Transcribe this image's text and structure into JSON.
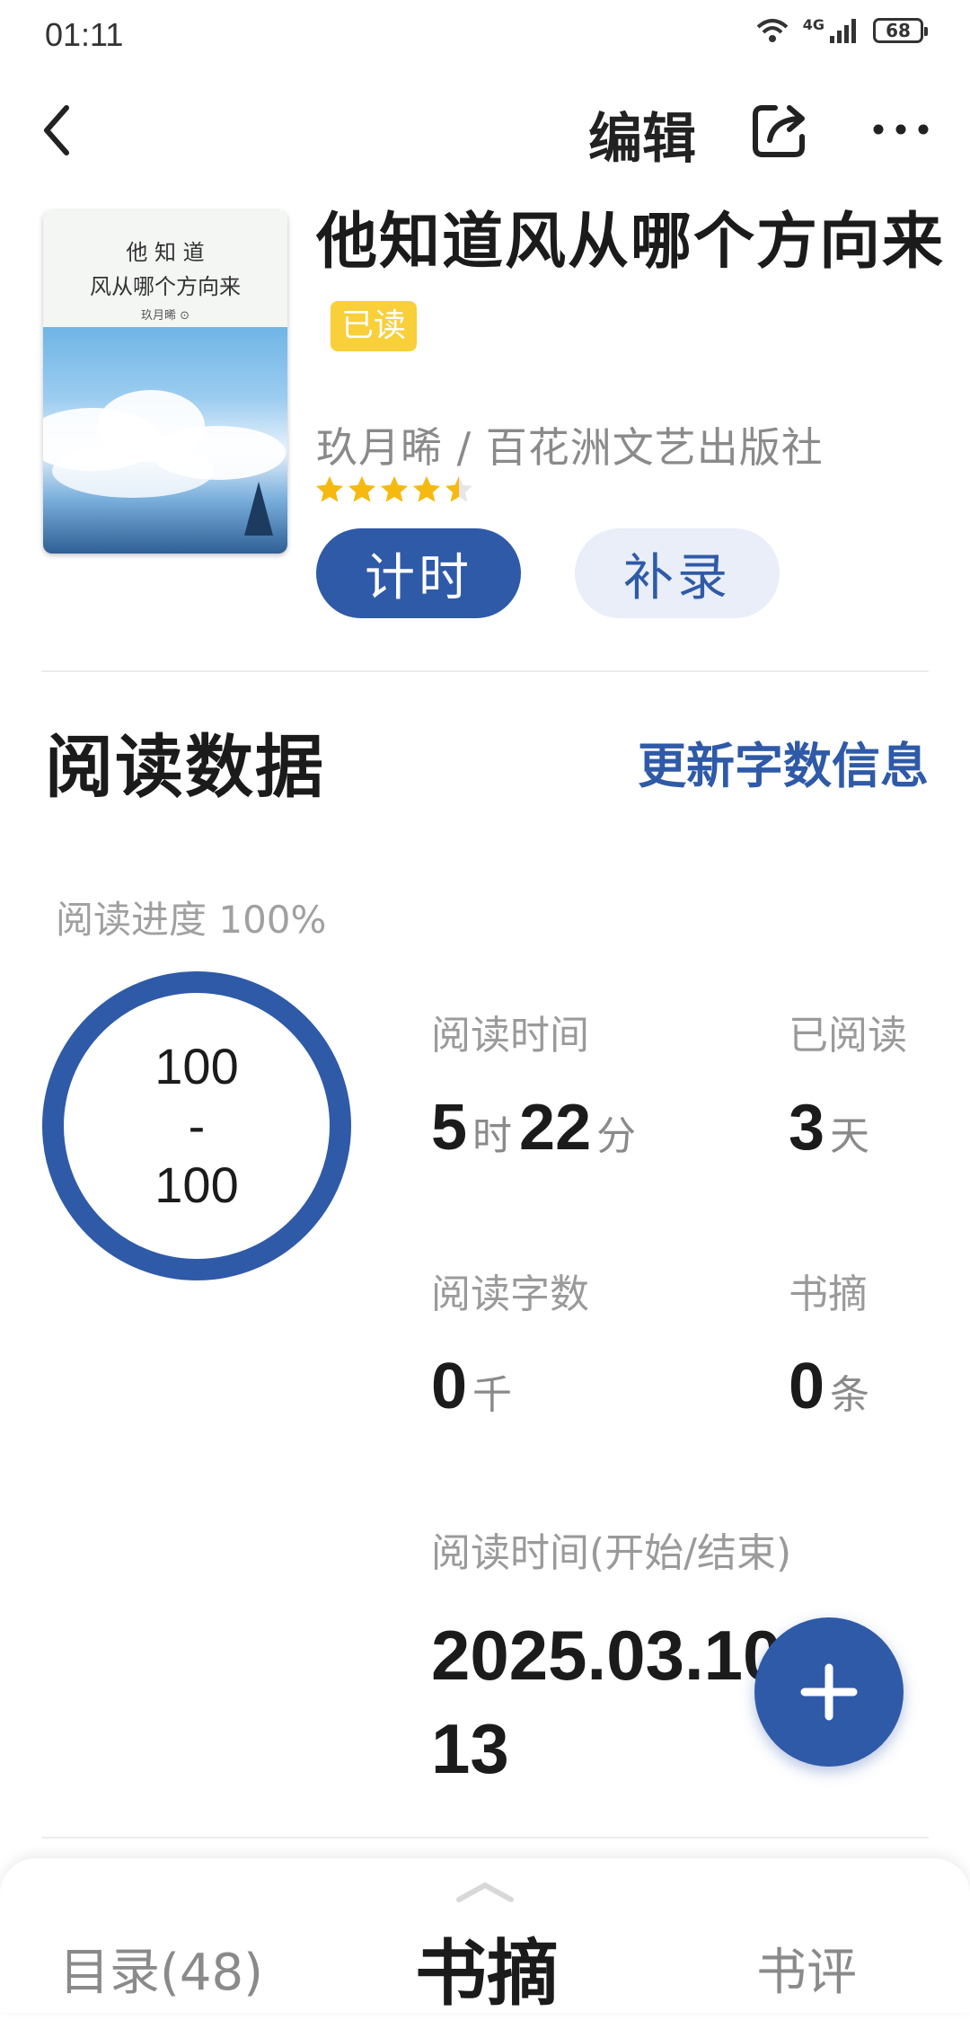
{
  "status_bar": {
    "time": "01:11",
    "network": "4G",
    "battery": "68"
  },
  "top_bar": {
    "edit_label": "编辑"
  },
  "cover": {
    "title_line1": "他 知 道",
    "title_line2": "风从哪个方向来",
    "author": "玖月晞 ⊙"
  },
  "book": {
    "title": "他知道风从哪个方向来",
    "badge": "已读",
    "meta": "玖月晞 / 百花洲文艺出版社",
    "rating": 4.5
  },
  "actions": {
    "timer_label": "计时",
    "record_label": "补录"
  },
  "reading_data": {
    "section_title": "阅读数据",
    "update_label": "更新字数信息",
    "progress_label": "阅读进度 100%",
    "progress_fraction": 1.0,
    "ring_top": "100",
    "ring_sep": "-",
    "ring_bottom": "100",
    "time_label": "阅读时间",
    "time_hours": "5",
    "time_hours_unit": "时",
    "time_minutes": "22",
    "time_minutes_unit": "分",
    "days_label": "已阅读",
    "days_value": "3",
    "days_unit": "天",
    "words_label": "阅读字数",
    "words_value": "0",
    "words_unit": "千",
    "excerpts_label": "书摘",
    "excerpts_value": "0",
    "excerpts_unit": "条",
    "period_label": "阅读时间(开始/结束)",
    "period_value": "2025.03.10-03.13"
  },
  "bottom_tabs": {
    "toc": "目录(48)",
    "excerpt": "书摘",
    "review": "书评"
  },
  "colors": {
    "accent": "#2f5aa8",
    "badge": "#f9cf3a",
    "star": "#f5b912"
  }
}
